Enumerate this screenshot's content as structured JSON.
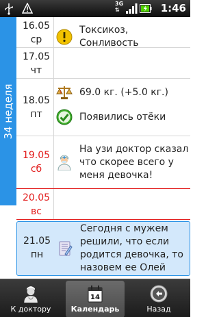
{
  "status_bar": {
    "time": "1:46",
    "network": "3G"
  },
  "week_label": "34 неделя",
  "days": [
    {
      "date": "16.05",
      "weekday": "ср",
      "events": [
        {
          "icon": "exclamation-icon",
          "text": "Токсикоз, Сонливость"
        }
      ]
    },
    {
      "date": "17.05",
      "weekday": "чт",
      "events": []
    },
    {
      "date": "18.05",
      "weekday": "пт",
      "events": [
        {
          "icon": "scales-icon",
          "text": "69.0 кг. (+5.0 кг.)"
        },
        {
          "icon": "checkmark-icon",
          "text": "Появились отёки"
        }
      ]
    },
    {
      "date": "19.05",
      "weekday": "сб",
      "weekend": true,
      "events": [
        {
          "icon": "doctor-icon",
          "text": "На узи доктор сказал что скорее всего у меня девочка!"
        }
      ]
    },
    {
      "date": "20.05",
      "weekday": "вс",
      "weekend": true,
      "events": []
    },
    {
      "date": "21.05",
      "weekday": "пн",
      "selected": true,
      "events": [
        {
          "icon": "note-icon",
          "text": "Сегодня с мужем решили, что если родится девочка, то назовем ее Олей"
        }
      ]
    }
  ],
  "bottom_tabs": [
    {
      "label": "К доктору",
      "icon": "doctor-icon"
    },
    {
      "label": "Календарь",
      "icon": "calendar-icon",
      "icon_text": "14",
      "active": true
    },
    {
      "label": "Назад",
      "icon": "back-icon"
    }
  ],
  "colors": {
    "accent": "#2b93e6",
    "weekend": "#e21b1b",
    "selected_bg": "#d3e8fb"
  }
}
